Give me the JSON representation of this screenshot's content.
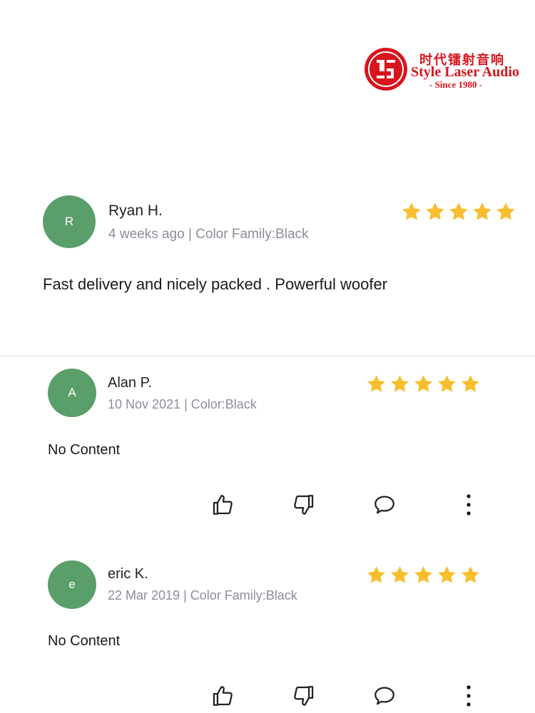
{
  "logo": {
    "chinese_text": "时代镭射音响",
    "english_text": "Style Laser Audio",
    "since_text": "- Since 1980 -",
    "brand_color": "#d8141c"
  },
  "colors": {
    "avatar_bg": "#5a9f6a",
    "star": "#f8be2e",
    "meta_text": "#8b8e9a"
  },
  "reviews": [
    {
      "avatar_initial": "R",
      "name": "Ryan H.",
      "meta": "4  weeks ago | Color Family:Black",
      "rating": 5,
      "content": "Fast delivery and nicely packed . Powerful woofer"
    },
    {
      "avatar_initial": "A",
      "name": "Alan P.",
      "meta": "10 Nov 2021 | Color:Black",
      "rating": 5,
      "content": "No Content"
    },
    {
      "avatar_initial": "e",
      "name": "eric K.",
      "meta": "22 Mar 2019 | Color Family:Black",
      "rating": 5,
      "content": "No Content"
    }
  ],
  "actions": [
    "thumbs-up-icon",
    "thumbs-down-icon",
    "comment-icon",
    "more-vertical-icon"
  ]
}
